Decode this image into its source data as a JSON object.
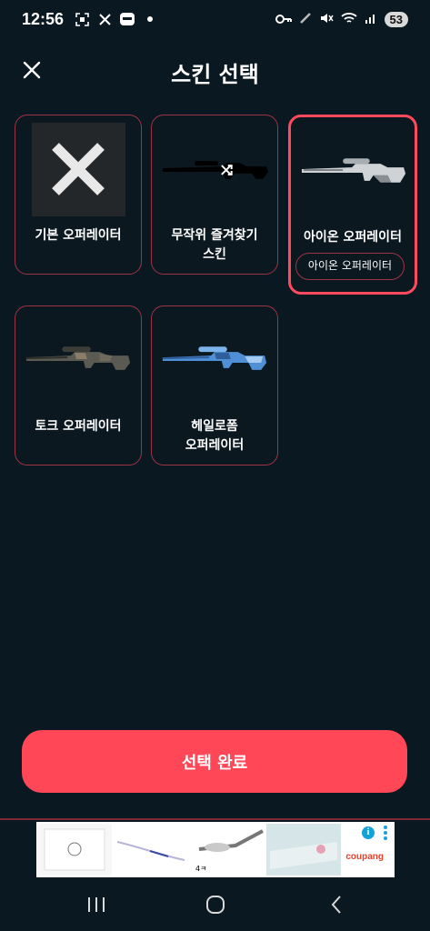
{
  "status_bar": {
    "time": "12:56",
    "battery": "53",
    "icons": [
      "screenshot-icon",
      "tools-icon",
      "app-icon",
      "dot-icon",
      "key-icon",
      "pen-icon",
      "mute-icon",
      "wifi-icon",
      "signal-icon"
    ]
  },
  "header": {
    "title": "스킨 선택",
    "close_icon": "close-icon"
  },
  "skins": [
    {
      "id": "default",
      "label": "기본 오퍼레이터",
      "thumbnail": "x-icon",
      "selected": false
    },
    {
      "id": "random",
      "label": "무작위 즐겨찾기\n스킨",
      "thumbnail": "shuffle-rifle",
      "selected": false
    },
    {
      "id": "iron",
      "label": "아이온 오퍼레이터",
      "thumbnail": "white-rifle",
      "selected": true,
      "chip": "아이온 오퍼레이터"
    },
    {
      "id": "toke",
      "label": "토크 오퍼레이터",
      "thumbnail": "camo-rifle",
      "selected": false
    },
    {
      "id": "helirom",
      "label": "헤일로폼\n오퍼레이터",
      "thumbnail": "blue-rifle",
      "selected": false
    }
  ],
  "confirm_button": {
    "label": "선택 완료"
  },
  "ad": {
    "brand": "coupang",
    "info": "i",
    "price_text": "4ㅋ"
  },
  "nav_bar": {
    "icons": [
      "recents-icon",
      "home-icon",
      "back-icon"
    ]
  },
  "colors": {
    "background": "#0a1821",
    "accent": "#ff4757",
    "card_border": "#9d3445"
  }
}
